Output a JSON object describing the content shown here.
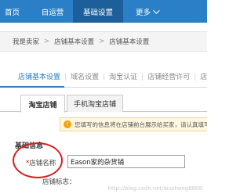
{
  "topnav": {
    "items": [
      {
        "label": "首页"
      },
      {
        "label": "自运营"
      },
      {
        "label": "基础设置",
        "active": true
      },
      {
        "label": "更多"
      }
    ],
    "bg_color": "#2b7fc7",
    "active_color": "#1d5f9b"
  },
  "breadcrumb": {
    "items": [
      "我是卖家",
      "店铺基本设置",
      "店铺基本设置"
    ],
    "separator": ">"
  },
  "subtabs": {
    "items": [
      "店铺基本设置",
      "域名设置",
      "淘宝认证",
      "店铺经营许可",
      "店"
    ],
    "active": 0
  },
  "innertabs": {
    "items": [
      "淘宝店铺",
      "手机淘宝店铺"
    ],
    "active": 0
  },
  "notice": {
    "icon": "warning-icon",
    "text": "您填写的信息将在店铺前台展示给买家，请认真填写"
  },
  "form": {
    "section_title": "基础信息",
    "required_mark": "*",
    "shop_name_label": "店铺名称",
    "shop_name_value": "Eason家的杂货铺",
    "shop_logo_label": "店铺标志："
  },
  "annotation": {
    "color": "#d91f1f"
  },
  "watermark": "http://blog.csdn.net/wuzhong8809"
}
